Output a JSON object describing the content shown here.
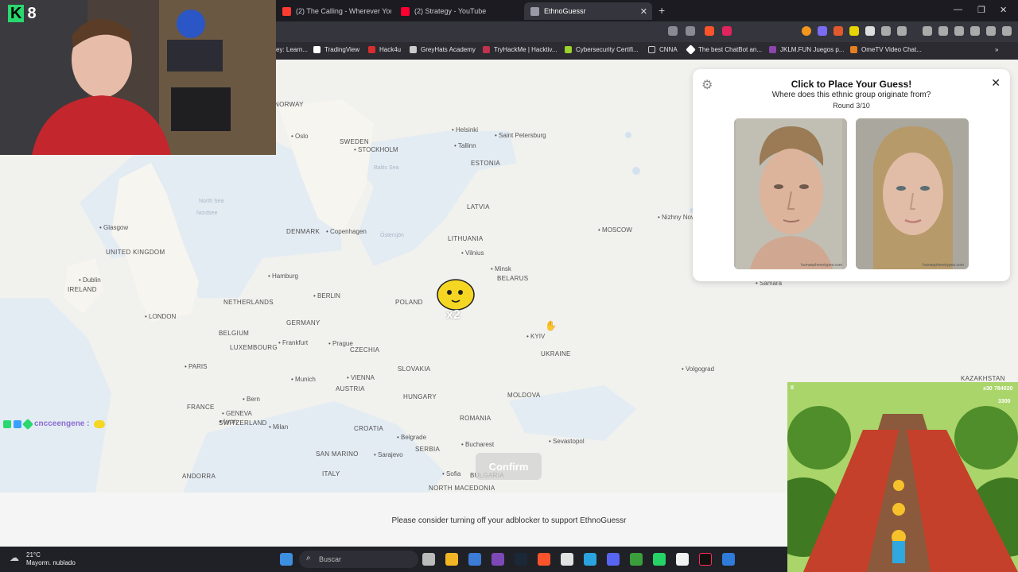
{
  "browser": {
    "tabs": [
      {
        "label": "(2) The Calling - Wherever You Will G",
        "color": "#ff3b30"
      },
      {
        "label": "(2) Strategy - YouTube",
        "color": "#ff0033"
      },
      {
        "label": "EthnoGuessr",
        "color": "#9a9aa6"
      }
    ],
    "active_tab_index": 2,
    "bookmarks": [
      "ey: Learn...",
      "TradingView",
      "Hack4u",
      "GreyHats Academy",
      "TryHackMe | Hacktiv...",
      "Cybersecurity Certifi...",
      "CNNA",
      "The best ChatBot an...",
      "JKLM.FUN Juegos p...",
      "OmeTV Video Chat..."
    ]
  },
  "map": {
    "countries": [
      {
        "name": "NORWAY"
      },
      {
        "name": "SWEDEN"
      },
      {
        "name": "ESTONIA"
      },
      {
        "name": "LATVIA"
      },
      {
        "name": "LITHUANIA"
      },
      {
        "name": "DENMARK"
      },
      {
        "name": "UNITED KINGDOM"
      },
      {
        "name": "IRELAND"
      },
      {
        "name": "BELARUS"
      },
      {
        "name": "POLAND"
      },
      {
        "name": "NETHERLANDS"
      },
      {
        "name": "GERMANY"
      },
      {
        "name": "BELGIUM"
      },
      {
        "name": "LUXEMBOURG"
      },
      {
        "name": "CZECHIA"
      },
      {
        "name": "UKRAINE"
      },
      {
        "name": "SLOVAKIA"
      },
      {
        "name": "FRANCE"
      },
      {
        "name": "AUSTRIA"
      },
      {
        "name": "MOLDOVA"
      },
      {
        "name": "HUNGARY"
      },
      {
        "name": "ROMANIA"
      },
      {
        "name": "SWITZERLAND"
      },
      {
        "name": "CROATIA"
      },
      {
        "name": "SERBIA"
      },
      {
        "name": "SAN MARINO"
      },
      {
        "name": "ITALY"
      },
      {
        "name": "BULGARIA"
      },
      {
        "name": "ANDORRA"
      },
      {
        "name": "NORTH MACEDONIA"
      },
      {
        "name": "KAZAKHSTAN"
      }
    ],
    "cities": [
      "Oslo",
      "STOCKHOLM",
      "Helsinki",
      "Tallinn",
      "Saint Petersburg",
      "Nizhny Nov",
      "Glasgow",
      "Copenhagen",
      "Vilnius",
      "MOSCOW",
      "Minsk",
      "Dublin",
      "Hamburg",
      "BERLIN",
      "LONDON",
      "Samara",
      "Frankfurt",
      "Prague",
      "KYIV",
      "PARIS",
      "Volgograd",
      "Munich",
      "VIENNA",
      "Bern",
      "GENEVA",
      "Lyon",
      "Milan",
      "Belgrade",
      "Bucharest",
      "Sevastopol",
      "Sarajevo",
      "Sofia"
    ],
    "seas": [
      "North Sea",
      "Nordsee",
      "Baltic Sea",
      "Östersjön"
    ],
    "pin_label": "x2"
  },
  "confirm_label": "Confirm",
  "panel": {
    "title": "Click to Place Your Guess!",
    "question": "Where does this ethnic group originate from?",
    "round": "Round 3/10",
    "watermark": "humanphenotypes.com"
  },
  "ad_notice": "Please consider turning off your adblocker to support EthnoGuessr",
  "stream": {
    "badge_number": "8",
    "chat_user": "cncceengene :"
  },
  "game": {
    "score": "784020",
    "multiplier": "x30",
    "coins": "3300"
  },
  "taskbar": {
    "temperature": "21°C",
    "weather": "Mayorm. nublado",
    "search_placeholder": "Buscar"
  }
}
